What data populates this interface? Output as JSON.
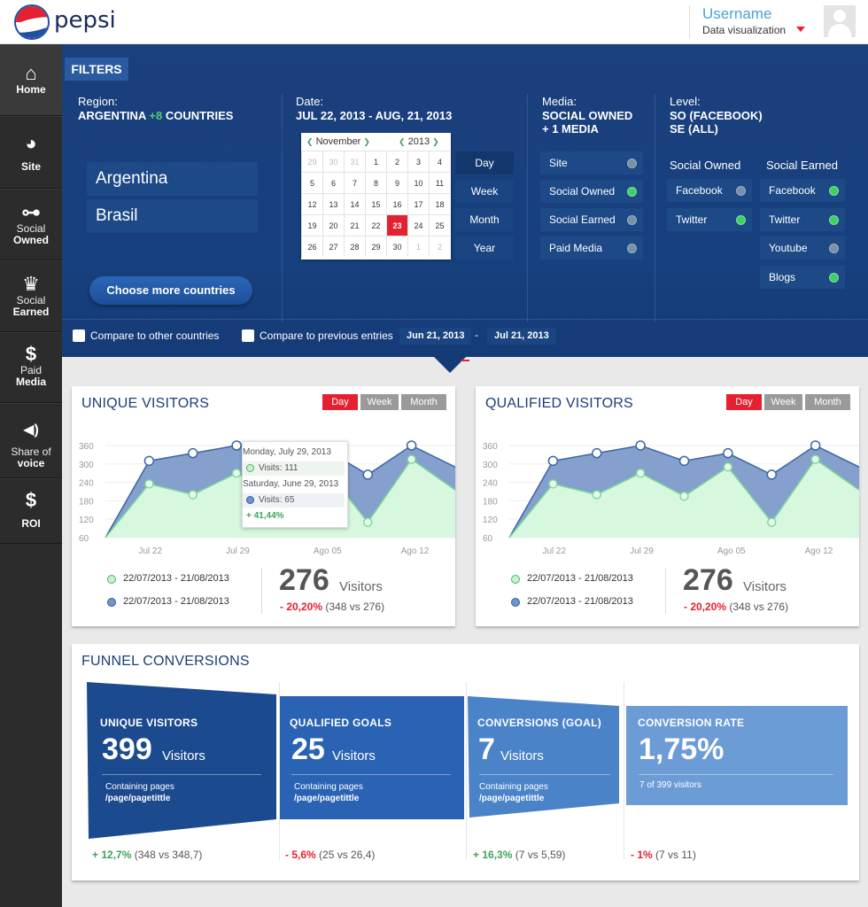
{
  "header": {
    "brand": "pepsi",
    "username": "Username",
    "subtitle": "Data visualization"
  },
  "sidebar": {
    "items": [
      {
        "icon": "home-icon",
        "glyph": "⌂",
        "line1": "Home",
        "line2": ""
      },
      {
        "icon": "globe-icon",
        "glyph": "◕",
        "line1": "Site",
        "line2": ""
      },
      {
        "icon": "key-icon",
        "glyph": "⊶",
        "line1": "Social",
        "line2": "Owned"
      },
      {
        "icon": "crown-icon",
        "glyph": "♛",
        "line1": "Social",
        "line2": "Earned"
      },
      {
        "icon": "dollar-icon",
        "glyph": "$",
        "line1": "Paid",
        "line2": "Media"
      },
      {
        "icon": "speaker-icon",
        "glyph": "◀)",
        "line1": "Share of",
        "line2": "voice"
      },
      {
        "icon": "dollar-icon",
        "glyph": "$",
        "line1": "ROI",
        "line2": ""
      }
    ]
  },
  "filters": {
    "tab": "FILTERS",
    "region": {
      "title": "Region:",
      "value": "ARGENTINA",
      "extra": "+8",
      "suffix": "COUNTRIES",
      "list": [
        "Argentina",
        "Brasil"
      ],
      "button": "Choose more countries"
    },
    "date": {
      "title": "Date:",
      "value": "JUL 22, 2013 - AUG, 21, 2013"
    },
    "calendar": {
      "month": "November",
      "year": "2013",
      "rows": [
        [
          "29",
          "30",
          "31",
          "1",
          "2",
          "3",
          "4"
        ],
        [
          "5",
          "6",
          "7",
          "8",
          "9",
          "10",
          "11"
        ],
        [
          "12",
          "13",
          "14",
          "15",
          "16",
          "17",
          "18"
        ],
        [
          "19",
          "20",
          "21",
          "22",
          "23",
          "24",
          "25"
        ],
        [
          "26",
          "27",
          "28",
          "29",
          "30",
          "1",
          "2"
        ]
      ],
      "selected": "23"
    },
    "granularity": [
      "Day",
      "Week",
      "Month",
      "Year"
    ],
    "media": {
      "title": "Media:",
      "value1": "SOCIAL OWNED",
      "value2": "+ 1 MEDIA",
      "items": [
        {
          "label": "Site",
          "on": false
        },
        {
          "label": "Social Owned",
          "on": true
        },
        {
          "label": "Social Earned",
          "on": false
        },
        {
          "label": "Paid Media",
          "on": false
        }
      ]
    },
    "level": {
      "title": "Level:",
      "value1": "SO (FACEBOOK)",
      "value2": "SE (ALL)",
      "owned_title": "Social Owned",
      "earned_title": "Social Earned",
      "owned": [
        {
          "label": "Facebook",
          "on": false
        },
        {
          "label": "Twitter",
          "on": true
        }
      ],
      "earned": [
        {
          "label": "Facebook",
          "on": true
        },
        {
          "label": "Twitter",
          "on": true
        },
        {
          "label": "Youtube",
          "on": false
        },
        {
          "label": "Blogs",
          "on": true
        }
      ]
    },
    "compare_countries": "Compare to other countries",
    "compare_previous": "Compare to previous entries",
    "compare_from": "Jun 21, 2013",
    "compare_sep": "-",
    "compare_to": "Jul 21, 2013"
  },
  "unique_visitors": {
    "title": "UNIQUE VISITORS",
    "tabs": [
      "Day",
      "Week",
      "Month"
    ],
    "legend": [
      "22/07/2013 - 21/08/2013",
      "22/07/2013 - 21/08/2013"
    ],
    "total": "276",
    "unit": "Visitors",
    "delta": "- 20,20%",
    "compare": "(348 vs 276)",
    "tooltip": {
      "line1": "Monday, July 29, 2013",
      "v1": "Visits: 111",
      "line2": "Saturday, June 29, 2013",
      "v2": "Visits: 65",
      "change": "+ 41,44%"
    }
  },
  "qualified_visitors": {
    "title": "QUALIFIED VISITORS",
    "tabs": [
      "Day",
      "Week",
      "Month"
    ],
    "legend": [
      "22/07/2013 - 21/08/2013",
      "22/07/2013 - 21/08/2013"
    ],
    "total": "276",
    "unit": "Visitors",
    "delta": "- 20,20%",
    "compare": "(348 vs 276)"
  },
  "chart_data": [
    {
      "type": "area",
      "title": "UNIQUE VISITORS",
      "x_ticks": [
        "Jul 22",
        "Jul 29",
        "Ago 05",
        "Ago 12"
      ],
      "y_ticks": [
        60,
        120,
        180,
        240,
        300,
        360
      ],
      "ylim": [
        60,
        360
      ],
      "series": [
        {
          "values": [
            60,
            310,
            335,
            360,
            330,
            350,
            265,
            360,
            290
          ]
        },
        {
          "values": [
            60,
            235,
            200,
            270,
            195,
            290,
            110,
            315,
            215
          ]
        }
      ]
    },
    {
      "type": "area",
      "title": "QUALIFIED VISITORS",
      "x_ticks": [
        "Jul 22",
        "Jul 29",
        "Ago 05",
        "Ago 12"
      ],
      "y_ticks": [
        60,
        120,
        180,
        240,
        300,
        360
      ],
      "ylim": [
        60,
        360
      ],
      "series": [
        {
          "values": [
            60,
            310,
            335,
            360,
            310,
            335,
            265,
            360,
            290
          ]
        },
        {
          "values": [
            60,
            235,
            200,
            270,
            195,
            290,
            110,
            315,
            215
          ]
        }
      ]
    }
  ],
  "funnel": {
    "title": "FUNNEL CONVERSIONS",
    "blocks": [
      {
        "title": "UNIQUE VISITORS",
        "num": "399",
        "unit": "Visitors",
        "small1": "Containing pages",
        "small2": "/page/pagetittle",
        "delta": "+ 12,7%",
        "compare": "(348 vs 348,7)",
        "color": "#1c4a8e"
      },
      {
        "title": "QUALIFIED GOALS",
        "num": "25",
        "unit": "Visitors",
        "small1": "Containing pages",
        "small2": "/page/pagetittle",
        "delta": "- 5,6%",
        "compare": "(25 vs 26,4)",
        "color": "#2a63b3"
      },
      {
        "title": "CONVERSIONS (GOAL)",
        "num": "7",
        "unit": "Visitors",
        "small1": "Containing pages",
        "small2": "/page/pagetittle",
        "delta": "+ 16,3%",
        "compare": "(7 vs 5,59)",
        "color": "#4b83c9"
      },
      {
        "title": "CONVERSION RATE",
        "num": "1,75%",
        "unit": "",
        "small1": "7 of 399 visitors",
        "small2": "",
        "delta": "- 1%",
        "compare": "(7 vs 11)",
        "color": "#6c9cd6"
      }
    ]
  }
}
